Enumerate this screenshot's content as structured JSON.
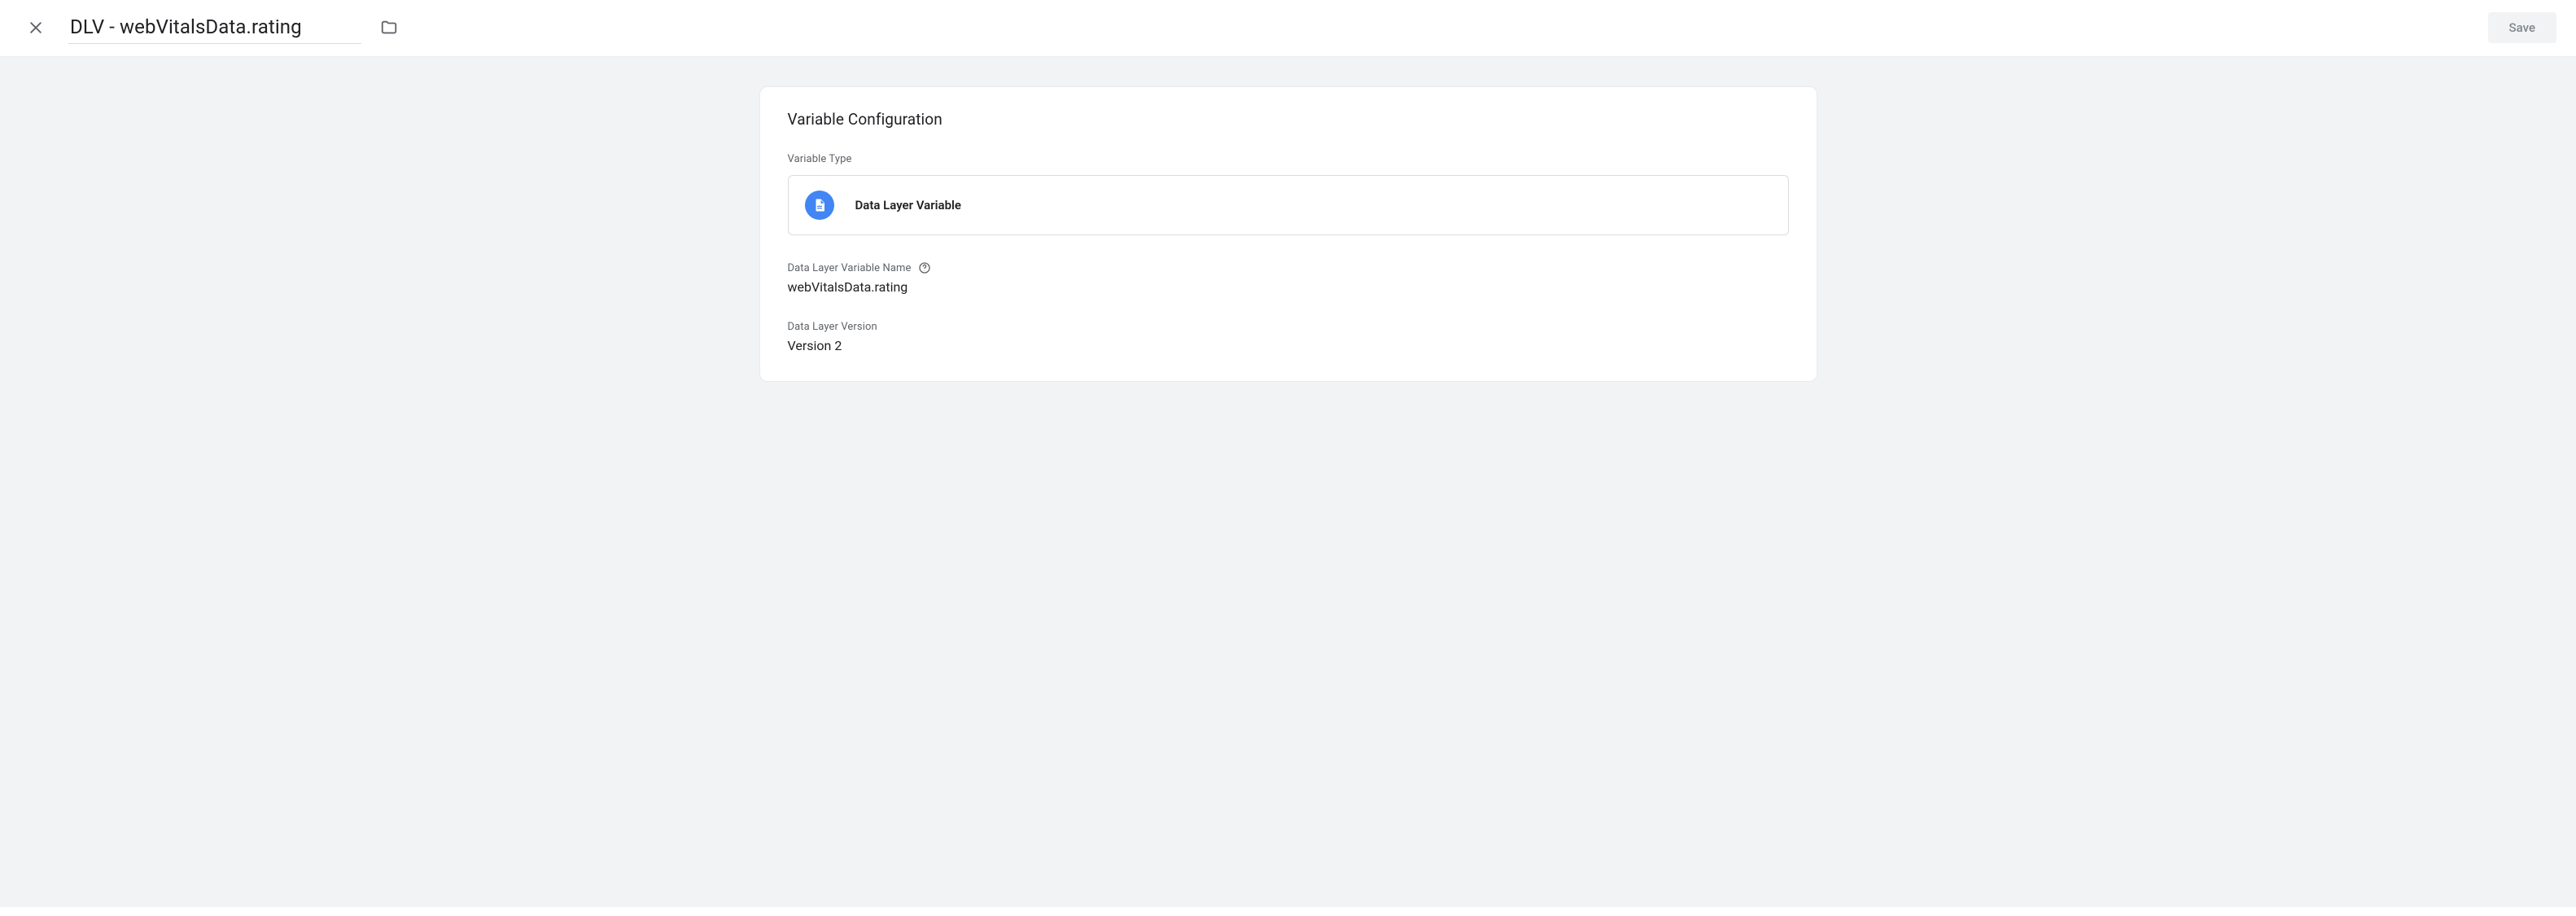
{
  "header": {
    "title": "DLV - webVitalsData.rating",
    "save_label": "Save"
  },
  "card": {
    "title": "Variable Configuration",
    "type_label": "Variable Type",
    "type_value": "Data Layer Variable",
    "name_label": "Data Layer Variable Name",
    "name_value": "webVitalsData.rating",
    "version_label": "Data Layer Version",
    "version_value": "Version 2"
  }
}
